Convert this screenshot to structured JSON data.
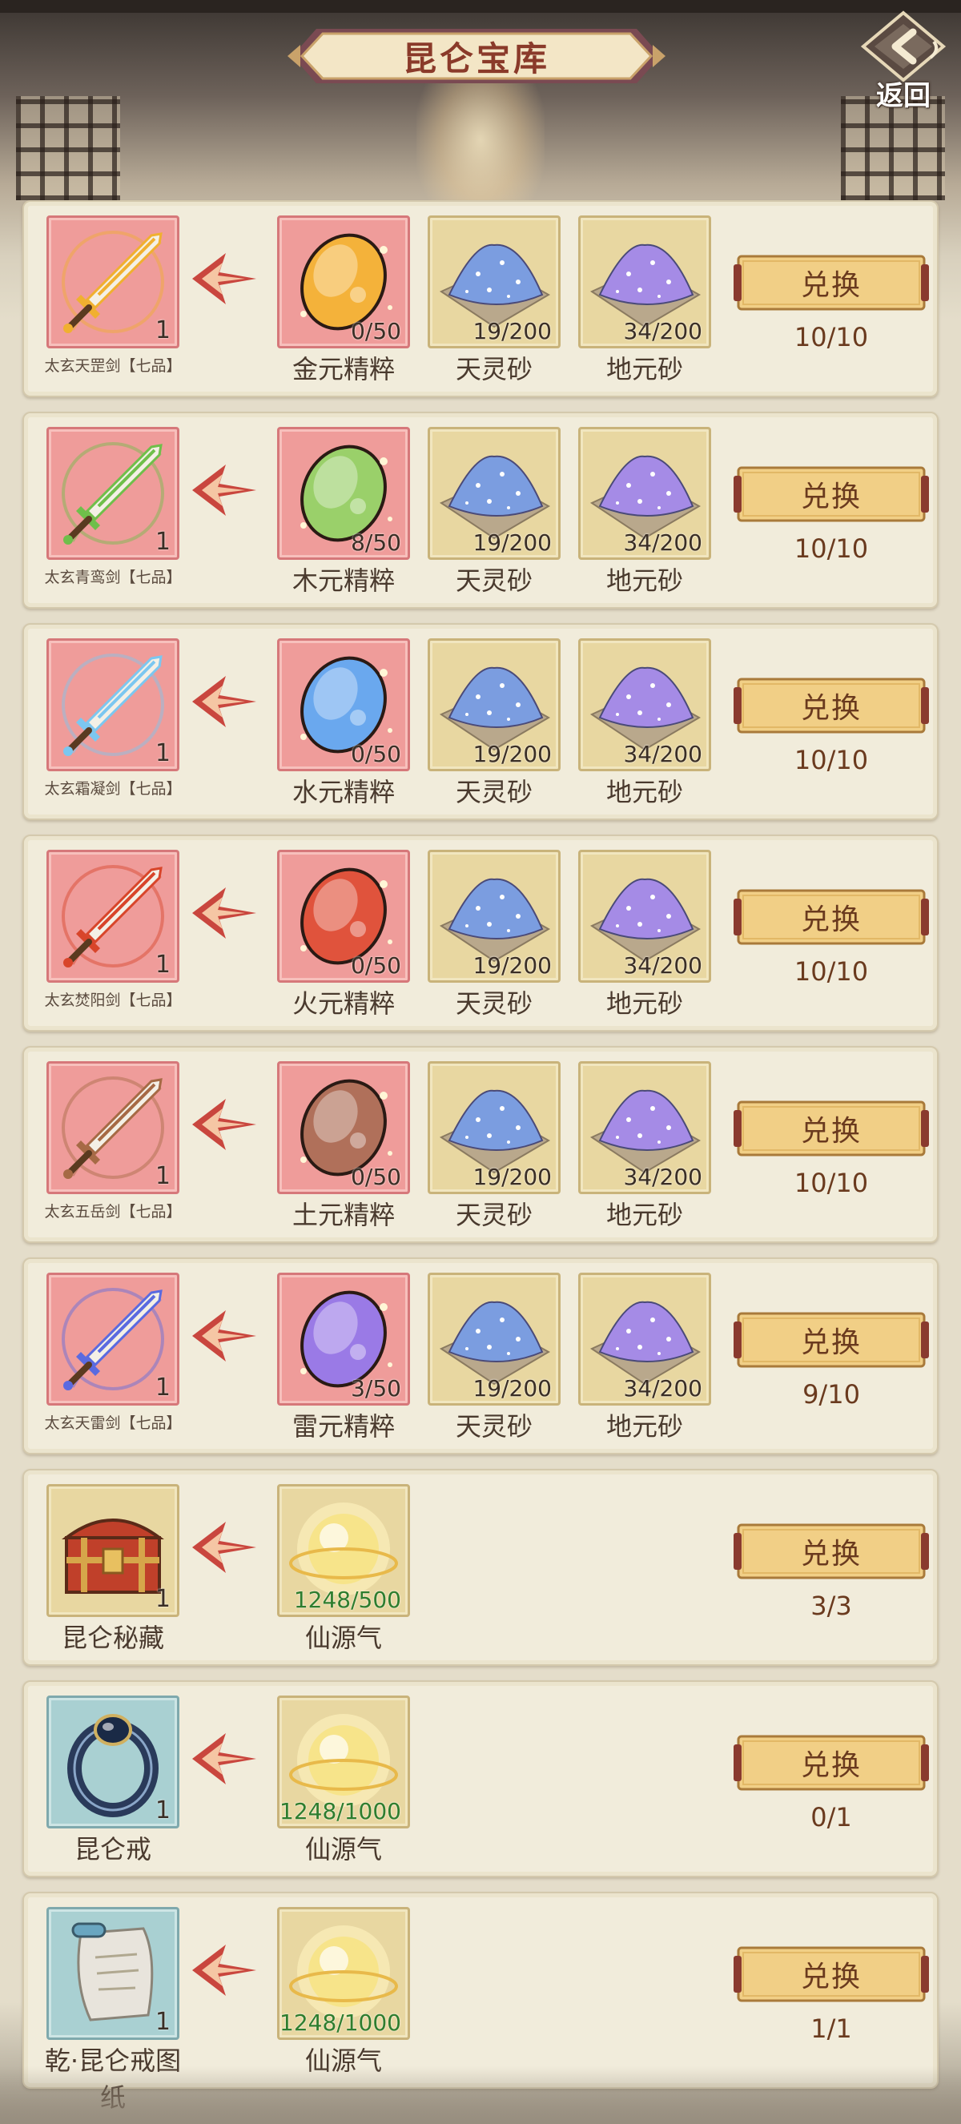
{
  "header": {
    "title": "昆仑宝库",
    "back_label": "返回"
  },
  "exchange_label": "兑换",
  "rows": [
    {
      "reward": {
        "name": "太玄天罡剑【七品】",
        "count": "1",
        "icon": "golden-sword-icon",
        "frame": "red",
        "color": "#f0b030"
      },
      "costs": [
        {
          "name": "金元精粹",
          "count": "0/50",
          "icon": "gold-essence-gem-icon",
          "frame": "red",
          "color": "#f4b23a"
        },
        {
          "name": "天灵砂",
          "count": "19/200",
          "icon": "blue-sand-pile-icon",
          "frame": "gold",
          "color": "#7b9de0"
        },
        {
          "name": "地元砂",
          "count": "34/200",
          "icon": "purple-sand-pile-icon",
          "frame": "gold",
          "color": "#a58be6"
        }
      ],
      "limit": "10/10"
    },
    {
      "reward": {
        "name": "太玄青鸾剑【七品】",
        "count": "1",
        "icon": "green-sword-icon",
        "frame": "red",
        "color": "#6fbf4a"
      },
      "costs": [
        {
          "name": "木元精粹",
          "count": "8/50",
          "icon": "wood-essence-gem-icon",
          "frame": "red",
          "color": "#9ad06a"
        },
        {
          "name": "天灵砂",
          "count": "19/200",
          "icon": "blue-sand-pile-icon",
          "frame": "gold",
          "color": "#7b9de0"
        },
        {
          "name": "地元砂",
          "count": "34/200",
          "icon": "purple-sand-pile-icon",
          "frame": "gold",
          "color": "#a58be6"
        }
      ],
      "limit": "10/10"
    },
    {
      "reward": {
        "name": "太玄霜凝剑【七品】",
        "count": "1",
        "icon": "ice-sword-icon",
        "frame": "red",
        "color": "#7cc7f0"
      },
      "costs": [
        {
          "name": "水元精粹",
          "count": "0/50",
          "icon": "water-essence-gem-icon",
          "frame": "red",
          "color": "#6aa8ee"
        },
        {
          "name": "天灵砂",
          "count": "19/200",
          "icon": "blue-sand-pile-icon",
          "frame": "gold",
          "color": "#7b9de0"
        },
        {
          "name": "地元砂",
          "count": "34/200",
          "icon": "purple-sand-pile-icon",
          "frame": "gold",
          "color": "#a58be6"
        }
      ],
      "limit": "10/10"
    },
    {
      "reward": {
        "name": "太玄焚阳剑【七品】",
        "count": "1",
        "icon": "fire-sword-icon",
        "frame": "red",
        "color": "#d8452a"
      },
      "costs": [
        {
          "name": "火元精粹",
          "count": "0/50",
          "icon": "fire-essence-gem-icon",
          "frame": "red",
          "color": "#e0533c"
        },
        {
          "name": "天灵砂",
          "count": "19/200",
          "icon": "blue-sand-pile-icon",
          "frame": "gold",
          "color": "#7b9de0"
        },
        {
          "name": "地元砂",
          "count": "34/200",
          "icon": "purple-sand-pile-icon",
          "frame": "gold",
          "color": "#a58be6"
        }
      ],
      "limit": "10/10"
    },
    {
      "reward": {
        "name": "太玄五岳剑【七品】",
        "count": "1",
        "icon": "earth-sword-icon",
        "frame": "red",
        "color": "#a66a45"
      },
      "costs": [
        {
          "name": "土元精粹",
          "count": "0/50",
          "icon": "earth-essence-gem-icon",
          "frame": "red",
          "color": "#b0705a"
        },
        {
          "name": "天灵砂",
          "count": "19/200",
          "icon": "blue-sand-pile-icon",
          "frame": "gold",
          "color": "#7b9de0"
        },
        {
          "name": "地元砂",
          "count": "34/200",
          "icon": "purple-sand-pile-icon",
          "frame": "gold",
          "color": "#a58be6"
        }
      ],
      "limit": "10/10"
    },
    {
      "reward": {
        "name": "太玄天雷剑【七品】",
        "count": "1",
        "icon": "thunder-sword-icon",
        "frame": "red",
        "color": "#5a6ae0"
      },
      "costs": [
        {
          "name": "雷元精粹",
          "count": "3/50",
          "icon": "thunder-essence-gem-icon",
          "frame": "red",
          "color": "#9a7ae6"
        },
        {
          "name": "天灵砂",
          "count": "19/200",
          "icon": "blue-sand-pile-icon",
          "frame": "gold",
          "color": "#7b9de0"
        },
        {
          "name": "地元砂",
          "count": "34/200",
          "icon": "purple-sand-pile-icon",
          "frame": "gold",
          "color": "#a58be6"
        }
      ],
      "limit": "9/10"
    },
    {
      "reward": {
        "name": "昆仑秘藏",
        "count": "1",
        "icon": "treasure-chest-icon",
        "frame": "gold",
        "color": "#c0402a"
      },
      "costs": [
        {
          "name": "仙源气",
          "count": "1248/500",
          "icon": "immortal-qi-orb-icon",
          "frame": "gold",
          "color": "#f7e48a",
          "sufficient": true
        }
      ],
      "limit": "3/3"
    },
    {
      "reward": {
        "name": "昆仑戒",
        "count": "1",
        "icon": "ring-icon",
        "frame": "blue",
        "color": "#2a3a5a"
      },
      "costs": [
        {
          "name": "仙源气",
          "count": "1248/1000",
          "icon": "immortal-qi-orb-icon",
          "frame": "gold",
          "color": "#f7e48a",
          "sufficient": true
        }
      ],
      "limit": "0/1"
    },
    {
      "reward": {
        "name": "乾·昆仑戒图纸",
        "count": "1",
        "icon": "blueprint-scroll-icon",
        "frame": "blue",
        "color": "#e8e4dc"
      },
      "costs": [
        {
          "name": "仙源气",
          "count": "1248/1000",
          "icon": "immortal-qi-orb-icon",
          "frame": "gold",
          "color": "#f7e48a",
          "sufficient": true
        }
      ],
      "limit": "1/1"
    }
  ]
}
